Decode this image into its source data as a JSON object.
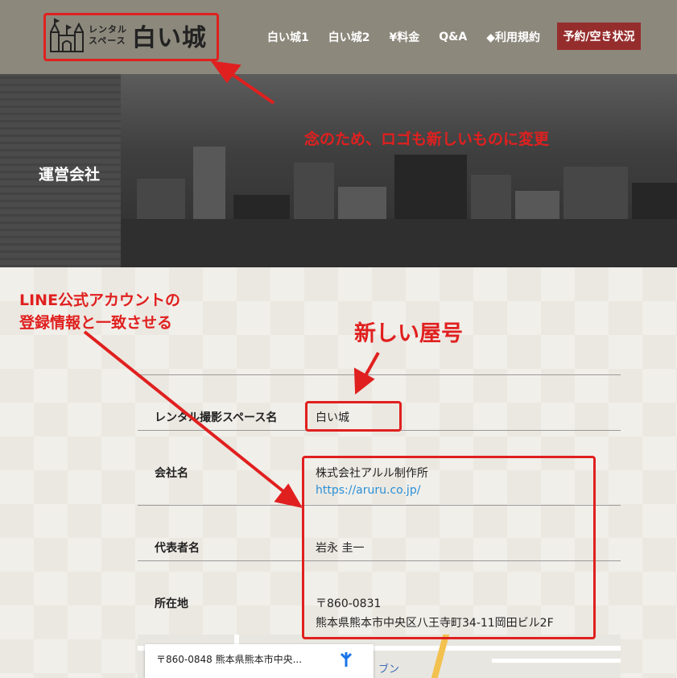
{
  "header": {
    "logo": {
      "sub_line1": "レンタル",
      "sub_line2": "スペース",
      "main": "白い城"
    },
    "nav": [
      {
        "label": "白い城1"
      },
      {
        "label": "白い城2"
      },
      {
        "label": "¥料金"
      },
      {
        "label": "Q&A"
      },
      {
        "label": "◆利用規約"
      }
    ],
    "cta_label": "予約/空き状況"
  },
  "hero": {
    "title": "運営会社"
  },
  "company_table": {
    "rows": [
      {
        "label": "レンタル撮影スペース名",
        "value": "白い城"
      },
      {
        "label": "会社名",
        "value": "株式会社アルル制作所",
        "link": "https://aruru.co.jp/"
      },
      {
        "label": "代表者名",
        "value": "岩永 圭一"
      },
      {
        "label": "所在地",
        "postal": "〒860-0831",
        "address": "熊本県熊本市中央区八王寺町34-11岡田ビル2F"
      }
    ]
  },
  "map": {
    "card_text": "〒860-0848 熊本県熊本市中央...",
    "label": "ブン"
  },
  "annotations": {
    "logo_note": "念のため、ロゴも新しいものに変更",
    "line_note_1": "LINE公式アカウントの",
    "line_note_2": "登録情報と一致させる",
    "name_note": "新しい屋号"
  },
  "colors": {
    "header_bg": "#8c887c",
    "cta_bg": "#962d2d",
    "annotation_red": "#e0201f",
    "link": "#2b8fd6"
  }
}
